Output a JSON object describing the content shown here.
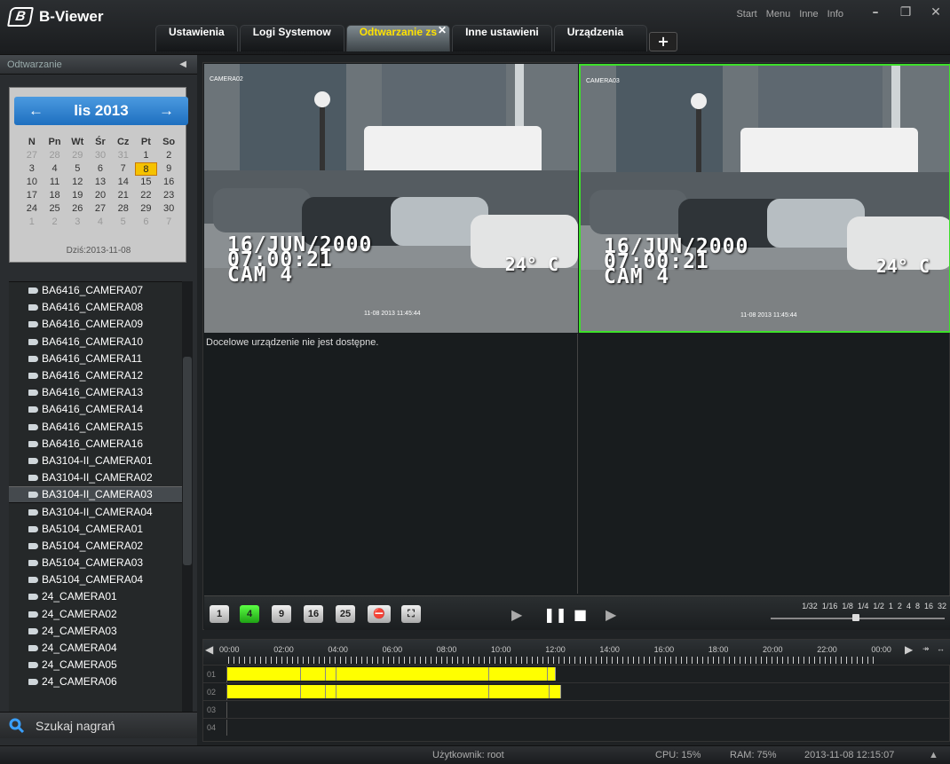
{
  "app": {
    "title": "B-Viewer",
    "logo_letter": "B"
  },
  "top_menu": [
    "Start",
    "Menu",
    "Inne",
    "Info"
  ],
  "window_controls": {
    "minimize": "–",
    "restore": "❐",
    "close": "✕"
  },
  "tabs": [
    {
      "label": "Ustawienia",
      "active": false
    },
    {
      "label": "Logi Systemow",
      "active": false
    },
    {
      "label": "Odtwarzanie zs",
      "active": true
    },
    {
      "label": "Inne ustawieni",
      "active": false
    },
    {
      "label": "Urządzenia",
      "active": false
    }
  ],
  "tab_add": "+",
  "left_panel": {
    "header": "Odtwarzanie",
    "calendar": {
      "month": "lis 2013",
      "prev": "←",
      "next": "→",
      "weekdays": [
        "N",
        "Pn",
        "Wt",
        "Śr",
        "Cz",
        "Pt",
        "So"
      ],
      "weeks": [
        [
          "27",
          "28",
          "29",
          "30",
          "31",
          "1",
          "2"
        ],
        [
          "3",
          "4",
          "5",
          "6",
          "7",
          "8",
          "9"
        ],
        [
          "10",
          "11",
          "12",
          "13",
          "14",
          "15",
          "16"
        ],
        [
          "17",
          "18",
          "19",
          "20",
          "21",
          "22",
          "23"
        ],
        [
          "24",
          "25",
          "26",
          "27",
          "28",
          "29",
          "30"
        ],
        [
          "1",
          "2",
          "3",
          "4",
          "5",
          "6",
          "7"
        ]
      ],
      "today_label": "Dziś:2013-11-08"
    },
    "cameras": [
      "BA6416_CAMERA07",
      "BA6416_CAMERA08",
      "BA6416_CAMERA09",
      "BA6416_CAMERA10",
      "BA6416_CAMERA11",
      "BA6416_CAMERA12",
      "BA6416_CAMERA13",
      "BA6416_CAMERA14",
      "BA6416_CAMERA15",
      "BA6416_CAMERA16",
      "BA3104-II_CAMERA01",
      "BA3104-II_CAMERA02",
      "BA3104-II_CAMERA03",
      "BA3104-II_CAMERA04",
      "BA5104_CAMERA01",
      "BA5104_CAMERA02",
      "BA5104_CAMERA03",
      "BA5104_CAMERA04",
      "24_CAMERA01",
      "24_CAMERA02",
      "24_CAMERA03",
      "24_CAMERA04",
      "24_CAMERA05",
      "24_CAMERA06"
    ],
    "selected_camera": "BA3104-II_CAMERA03",
    "search_label": "Szukaj nagrań"
  },
  "video": {
    "tiles": [
      {
        "label": "CAMERA02",
        "date": "16/JUN/2000",
        "time": "07:00:21",
        "cam": "CAM 4",
        "temp": "24° C",
        "stamp": "11-08 2013 11:45:44"
      },
      {
        "label": "CAMERA03",
        "date": "16/JUN/2000",
        "time": "07:00:21",
        "cam": "CAM 4",
        "temp": "24° C",
        "stamp": "11-08 2013 11:45:44"
      }
    ],
    "unavailable_msg": "Docelowe urządzenie nie jest dostępne.",
    "layouts": [
      "1",
      "4",
      "9",
      "16",
      "25"
    ],
    "speeds": [
      "1/32",
      "1/16",
      "1/8",
      "1/4",
      "1/2",
      "1",
      "2",
      "4",
      "8",
      "16",
      "32"
    ]
  },
  "timeline": {
    "hours": [
      "00:00",
      "02:00",
      "04:00",
      "06:00",
      "08:00",
      "10:00",
      "12:00",
      "14:00",
      "16:00",
      "18:00",
      "20:00",
      "22:00",
      "00:00"
    ],
    "rows": [
      "01",
      "02",
      "03",
      "04"
    ]
  },
  "status": {
    "user": "Użytkownik: root",
    "cpu": "CPU: 15%",
    "ram": "RAM: 75%",
    "datetime": "2013-11-08 12:15:07"
  }
}
